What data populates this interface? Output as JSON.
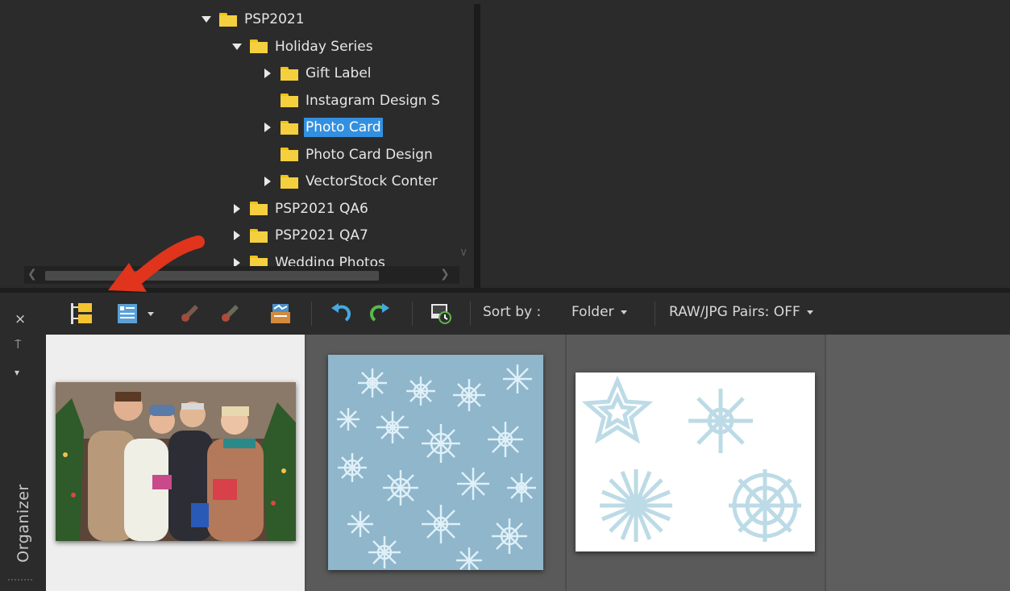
{
  "tree": {
    "rows": [
      {
        "label": "PSP2021",
        "state": "expanded"
      },
      {
        "label": "Holiday Series",
        "state": "expanded"
      },
      {
        "label": "Gift Label",
        "state": "collapsed"
      },
      {
        "label": "Instagram Design S",
        "state": "none"
      },
      {
        "label": "Photo Card",
        "state": "collapsed",
        "selected": true
      },
      {
        "label": "Photo Card Design",
        "state": "none"
      },
      {
        "label": "VectorStock Conter",
        "state": "collapsed"
      },
      {
        "label": "PSP2021 QA6",
        "state": "collapsed"
      },
      {
        "label": "PSP2021 QA7",
        "state": "collapsed"
      },
      {
        "label": "Wedding Photos",
        "state": "collapsed"
      }
    ]
  },
  "sidebar": {
    "close_icon": "×",
    "pin_icon": "⍑",
    "menu_icon": "▾",
    "label": "Organizer"
  },
  "toolbar": {
    "sort_label": "Sort by :",
    "sort_value": "Folder",
    "raw_pairs": "RAW/JPG Pairs: OFF"
  },
  "colors": {
    "selection": "#3390e0",
    "folder": "#f4d03f",
    "highlight_arrow": "#e0341c"
  }
}
